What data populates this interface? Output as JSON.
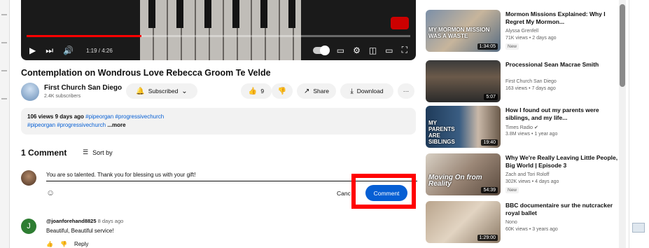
{
  "player": {
    "time": "1:19 / 4:26",
    "progress": 0.3,
    "controls": [
      "play-icon",
      "next-icon",
      "volume-icon",
      "autoplay-toggle",
      "captions-icon",
      "settings-icon",
      "miniplayer-icon",
      "theater-icon",
      "fullscreen-icon"
    ]
  },
  "video": {
    "title": "Contemplation on Wondrous Love Rebecca Groom Te Velde",
    "channel": "First Church San Diego",
    "subscribers": "2.4K subscribers",
    "subscribed_label": "Subscribed",
    "likes": "9",
    "share_label": "Share",
    "download_label": "Download",
    "more_label": "···"
  },
  "description": {
    "meta": "106 views  9 days ago",
    "tags_line1": "#pipeorgan #progressivechurch",
    "tags_line2": "#pipeorgan #progressivechurch",
    "more": "...more"
  },
  "comments": {
    "count_label": "1 Comment",
    "sort_label": "Sort by",
    "draft": "You are so talented. Thank you for blessing us with your gift!",
    "cancel_label": "Canc",
    "comment_button": "Comment",
    "items": [
      {
        "avatar_letter": "J",
        "author": "@joanforehand8825",
        "time": "8 days ago",
        "text": "Beautiful, Beautiful service!",
        "reply_label": "Reply"
      }
    ]
  },
  "related": [
    {
      "title": "Mormon Missions Explained: Why I Regret My Mormon...",
      "channel": "Alyssa Grenfell",
      "meta": "71K views • 2 days ago",
      "badge": "New",
      "duration": "1:34:05",
      "overlay": "MY MORMON MISSION WAS A WASTE"
    },
    {
      "title": "Processional Sean Macrae Smith",
      "channel": "First Church San Diego",
      "meta": "163 views • 7 days ago",
      "badge": "",
      "duration": "5:07",
      "overlay": ""
    },
    {
      "title": "How I found out my parents were siblings, and my life...",
      "channel": "Times Radio ✔",
      "meta": "3.8M views • 1 year ago",
      "badge": "",
      "duration": "19:40",
      "overlay": "MY PARENTS ARE SIBLINGS"
    },
    {
      "title": "Why We're Really Leaving Little People, Big World | Episode 3",
      "channel": "Zach and Tori Roloff",
      "meta": "302K views • 4 days ago",
      "badge": "New",
      "duration": "54:39",
      "overlay": "Moving On from Reality"
    },
    {
      "title": "BBC documentaire sur the nutcracker royal ballet",
      "channel": "Nono",
      "meta": "60K views • 3 years ago",
      "badge": "",
      "duration": "1:29:00",
      "overlay": ""
    }
  ],
  "colors": {
    "accent": "#065fd4",
    "highlight": "#ff0000",
    "progress": "#ff0000"
  }
}
